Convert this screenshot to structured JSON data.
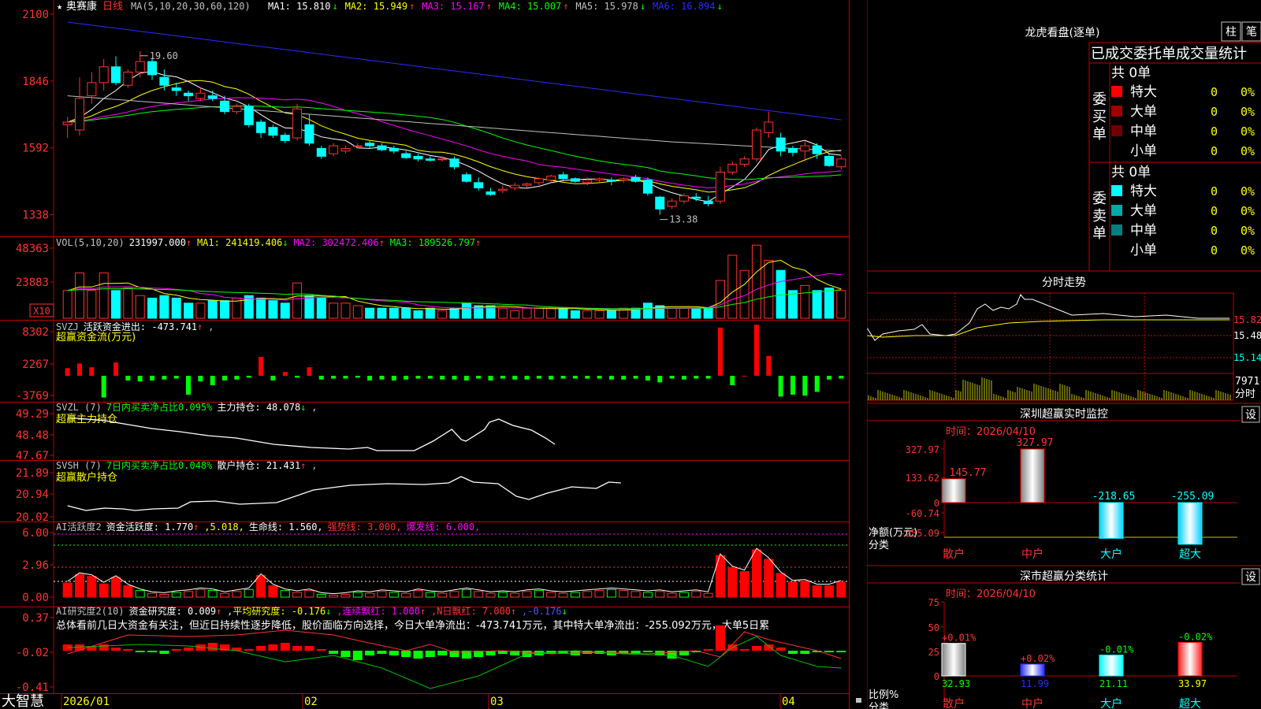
{
  "app": {
    "name": "大智慧",
    "stock_name": "奥赛康",
    "period": "日线"
  },
  "colors": {
    "up": "#ff3232",
    "down": "#00ffff",
    "grid": "#c00000",
    "ma1": "#ffffff",
    "ma2": "#ffff00",
    "ma3": "#ff00ff",
    "ma4": "#00ff00",
    "ma5": "#c0c0c0",
    "ma6": "#2b2bff"
  },
  "header": {
    "ma_label": "MA(5,10,20,30,60,120)",
    "items": [
      {
        "label": "MA1:",
        "value": "15.810",
        "arrow": "↓",
        "color": "#ffffff"
      },
      {
        "label": "MA2:",
        "value": "15.949",
        "arrow": "↑",
        "color": "#ffff00"
      },
      {
        "label": "MA3:",
        "value": "15.167",
        "arrow": "↑",
        "color": "#ff00ff"
      },
      {
        "label": "MA4:",
        "value": "15.007",
        "arrow": "↑",
        "color": "#00ff00"
      },
      {
        "label": "MA5:",
        "value": "15.978",
        "arrow": "↓",
        "color": "#c0c0c0"
      },
      {
        "label": "MA6:",
        "value": "16.894",
        "arrow": "↓",
        "color": "#2b2bff"
      }
    ]
  },
  "chart_data": [
    {
      "type": "candlestick",
      "title": "奥赛康 日线",
      "y_ticks": [
        "2100",
        "1846",
        "1592",
        "1338"
      ],
      "ylim": [
        12.8,
        21.0
      ],
      "annotations": [
        {
          "text": "19.60"
        },
        {
          "text": "13.38"
        }
      ],
      "x_labels": [
        "2026/01",
        "02",
        "03",
        "04"
      ],
      "candles": [
        {
          "o": 16.8,
          "h": 17.1,
          "l": 16.3,
          "c": 16.9
        },
        {
          "o": 16.6,
          "h": 18.6,
          "l": 16.4,
          "c": 17.8
        },
        {
          "o": 17.9,
          "h": 18.8,
          "l": 17.6,
          "c": 18.4
        },
        {
          "o": 18.4,
          "h": 19.3,
          "l": 18.1,
          "c": 19.0
        },
        {
          "o": 19.0,
          "h": 19.4,
          "l": 18.3,
          "c": 18.4
        },
        {
          "o": 18.3,
          "h": 18.9,
          "l": 18.2,
          "c": 18.8
        },
        {
          "o": 18.8,
          "h": 19.6,
          "l": 18.6,
          "c": 19.2
        },
        {
          "o": 19.2,
          "h": 19.3,
          "l": 18.5,
          "c": 18.7
        },
        {
          "o": 18.6,
          "h": 18.9,
          "l": 18.1,
          "c": 18.3
        },
        {
          "o": 18.2,
          "h": 18.4,
          "l": 17.9,
          "c": 18.1
        },
        {
          "o": 18.0,
          "h": 18.1,
          "l": 17.7,
          "c": 17.9
        },
        {
          "o": 17.8,
          "h": 18.2,
          "l": 17.7,
          "c": 18.0
        },
        {
          "o": 17.9,
          "h": 18.1,
          "l": 17.7,
          "c": 17.8
        },
        {
          "o": 17.7,
          "h": 17.9,
          "l": 17.2,
          "c": 17.3
        },
        {
          "o": 17.3,
          "h": 17.6,
          "l": 17.2,
          "c": 17.5
        },
        {
          "o": 17.5,
          "h": 17.6,
          "l": 16.7,
          "c": 16.8
        },
        {
          "o": 16.9,
          "h": 17.0,
          "l": 16.3,
          "c": 16.5
        },
        {
          "o": 16.7,
          "h": 16.8,
          "l": 16.3,
          "c": 16.4
        },
        {
          "o": 16.4,
          "h": 16.5,
          "l": 16.1,
          "c": 16.2
        },
        {
          "o": 16.3,
          "h": 17.6,
          "l": 16.2,
          "c": 17.4
        },
        {
          "o": 16.8,
          "h": 17.2,
          "l": 16.0,
          "c": 16.1
        },
        {
          "o": 15.9,
          "h": 16.0,
          "l": 15.5,
          "c": 15.6
        },
        {
          "o": 15.7,
          "h": 16.1,
          "l": 15.6,
          "c": 16.0
        },
        {
          "o": 15.8,
          "h": 16.0,
          "l": 15.7,
          "c": 15.9
        },
        {
          "o": 16.0,
          "h": 16.1,
          "l": 15.9,
          "c": 16.0
        },
        {
          "o": 16.1,
          "h": 16.2,
          "l": 15.9,
          "c": 16.0
        },
        {
          "o": 16.0,
          "h": 16.1,
          "l": 15.8,
          "c": 15.85
        },
        {
          "o": 15.9,
          "h": 16.0,
          "l": 15.7,
          "c": 15.8
        },
        {
          "o": 15.7,
          "h": 15.8,
          "l": 15.5,
          "c": 15.55
        },
        {
          "o": 15.6,
          "h": 15.7,
          "l": 15.4,
          "c": 15.5
        },
        {
          "o": 15.5,
          "h": 15.6,
          "l": 15.4,
          "c": 15.45
        },
        {
          "o": 15.5,
          "h": 15.6,
          "l": 15.4,
          "c": 15.5
        },
        {
          "o": 15.5,
          "h": 15.6,
          "l": 15.1,
          "c": 15.2
        },
        {
          "o": 14.9,
          "h": 15.0,
          "l": 14.6,
          "c": 14.65
        },
        {
          "o": 14.6,
          "h": 14.8,
          "l": 14.3,
          "c": 14.4
        },
        {
          "o": 14.25,
          "h": 14.4,
          "l": 14.1,
          "c": 14.15
        },
        {
          "o": 14.3,
          "h": 14.5,
          "l": 14.2,
          "c": 14.35
        },
        {
          "o": 14.4,
          "h": 14.6,
          "l": 14.3,
          "c": 14.5
        },
        {
          "o": 14.5,
          "h": 14.6,
          "l": 14.4,
          "c": 14.55
        },
        {
          "o": 14.6,
          "h": 14.8,
          "l": 14.5,
          "c": 14.75
        },
        {
          "o": 14.7,
          "h": 14.9,
          "l": 14.6,
          "c": 14.85
        },
        {
          "o": 14.9,
          "h": 15.0,
          "l": 14.7,
          "c": 14.75
        },
        {
          "o": 14.75,
          "h": 14.8,
          "l": 14.6,
          "c": 14.65
        },
        {
          "o": 14.6,
          "h": 14.8,
          "l": 14.5,
          "c": 14.7
        },
        {
          "o": 14.7,
          "h": 14.8,
          "l": 14.6,
          "c": 14.75
        },
        {
          "o": 14.7,
          "h": 14.8,
          "l": 14.5,
          "c": 14.65
        },
        {
          "o": 14.7,
          "h": 14.8,
          "l": 14.6,
          "c": 14.75
        },
        {
          "o": 14.8,
          "h": 14.9,
          "l": 14.6,
          "c": 14.65
        },
        {
          "o": 14.7,
          "h": 14.8,
          "l": 14.1,
          "c": 14.2
        },
        {
          "o": 14.05,
          "h": 14.1,
          "l": 13.38,
          "c": 13.6
        },
        {
          "o": 13.7,
          "h": 14.0,
          "l": 13.6,
          "c": 13.9
        },
        {
          "o": 13.9,
          "h": 14.2,
          "l": 13.8,
          "c": 14.1
        },
        {
          "o": 14.05,
          "h": 14.2,
          "l": 13.9,
          "c": 14.0
        },
        {
          "o": 13.9,
          "h": 14.1,
          "l": 13.7,
          "c": 13.8
        },
        {
          "o": 13.9,
          "h": 15.2,
          "l": 13.8,
          "c": 15.0
        },
        {
          "o": 15.0,
          "h": 15.4,
          "l": 14.9,
          "c": 15.3
        },
        {
          "o": 15.3,
          "h": 15.6,
          "l": 15.2,
          "c": 15.5
        },
        {
          "o": 15.5,
          "h": 16.7,
          "l": 15.4,
          "c": 16.6
        },
        {
          "o": 16.5,
          "h": 17.3,
          "l": 16.3,
          "c": 16.9
        },
        {
          "o": 16.3,
          "h": 16.5,
          "l": 15.6,
          "c": 15.8
        },
        {
          "o": 15.9,
          "h": 16.0,
          "l": 15.6,
          "c": 15.75
        },
        {
          "o": 15.8,
          "h": 16.2,
          "l": 15.4,
          "c": 16.0
        },
        {
          "o": 16.0,
          "h": 16.1,
          "l": 15.5,
          "c": 15.7
        },
        {
          "o": 15.6,
          "h": 15.7,
          "l": 15.2,
          "c": 15.25
        },
        {
          "o": 15.2,
          "h": 15.6,
          "l": 15.1,
          "c": 15.5
        }
      ],
      "series": [
        {
          "name": "MA1",
          "color": "#ffffff"
        },
        {
          "name": "MA2",
          "color": "#ffff00"
        },
        {
          "name": "MA3",
          "color": "#ff00ff"
        },
        {
          "name": "MA4",
          "color": "#00ff00"
        },
        {
          "name": "MA5",
          "color": "#c0c0c0"
        },
        {
          "name": "MA6",
          "color": "#2b2bff"
        }
      ]
    },
    {
      "type": "bar",
      "title": "VOL(5,10,20)",
      "y_ticks": [
        "48363",
        "23883"
      ],
      "unit_label": "X10",
      "header": [
        {
          "text": "VOL(5,10,20)",
          "color": "#c0c0c0"
        },
        {
          "text": "231997.000",
          "color": "#ffffff",
          "arrow": "↑"
        },
        {
          "text": "MA1: 241419.406",
          "color": "#ffff00",
          "arrow": "↓"
        },
        {
          "text": "MA2: 302472.406",
          "color": "#ff00ff",
          "arrow": "↑"
        },
        {
          "text": "MA3: 189526.797",
          "color": "#00ff00",
          "arrow": "↑"
        }
      ]
    },
    {
      "type": "bar",
      "title": "SVZJ",
      "y_ticks": [
        "8302",
        "2267",
        "-3769"
      ],
      "header": [
        {
          "text": "SVZJ",
          "color": "#c0c0c0"
        },
        {
          "text": "活跃资金进出: -473.741",
          "color": "#ffffff",
          "arrow": "↑"
        },
        {
          "text": ",",
          "color": "#c0c0c0"
        }
      ],
      "subtitle": "超赢资金流(万元)"
    },
    {
      "type": "line",
      "title": "SVZL",
      "y_ticks": [
        "49.29",
        "48.48",
        "47.67"
      ],
      "header": [
        {
          "text": "SVZL (7)",
          "color": "#c0c0c0"
        },
        {
          "text": "7日内买卖净占比0.095%",
          "color": "#00ff00"
        },
        {
          "text": "主力持仓: 48.078",
          "color": "#ffffff",
          "arrow": "↓"
        },
        {
          "text": ",",
          "color": "#c0c0c0"
        }
      ],
      "subtitle": "超赢主力持仓"
    },
    {
      "type": "line",
      "title": "SVSH",
      "y_ticks": [
        "21.89",
        "20.94",
        "20.02"
      ],
      "header": [
        {
          "text": "SVSH (7)",
          "color": "#c0c0c0"
        },
        {
          "text": "7日内买卖净占比0.048%",
          "color": "#00ff00"
        },
        {
          "text": "散户持仓: 21.431",
          "color": "#ffffff",
          "arrow": "↑"
        },
        {
          "text": ",",
          "color": "#c0c0c0"
        }
      ],
      "subtitle": "超赢散户持仓"
    },
    {
      "type": "bar",
      "title": "AI活跃度2",
      "y_ticks": [
        "6.00",
        "2.96",
        "0.00"
      ],
      "header": [
        {
          "text": "AI活跃度2",
          "color": "#c0c0c0"
        },
        {
          "text": "资金活跃度: 1.770",
          "color": "#ffffff",
          "arrow": "↑"
        },
        {
          "text": ",5.018,",
          "color": "#ffff00"
        },
        {
          "text": "生命线: 1.560,",
          "color": "#ffffff"
        },
        {
          "text": "强势线: 3.000,",
          "color": "#ff3232"
        },
        {
          "text": "爆发线: 6.000,",
          "color": "#ff00ff"
        }
      ]
    },
    {
      "type": "bar",
      "title": "AI研究度2(10)",
      "y_ticks": [
        "0.37",
        "-0.02",
        "-0.41"
      ],
      "header": [
        {
          "text": "AI研究度2(10)",
          "color": "#c0c0c0"
        },
        {
          "text": "资金研究度: 0.009",
          "color": "#ffffff",
          "arrow": "↑"
        },
        {
          "text": ",平均研究度: -0.176",
          "color": "#ffff00",
          "arrow": "↓"
        },
        {
          "text": ",连续飘红: 1.000",
          "color": "#ff00ff",
          "arrow": "↑"
        },
        {
          "text": ",N日飘红: 7.000",
          "color": "#ff3232",
          "arrow": "↑"
        },
        {
          "text": ",-0.176",
          "color": "#5555ff",
          "arrow": "↓"
        }
      ],
      "comment": "总体看前几日大资金有关注，但近日持续性逐步降低，股价面临方向选择，今日大单净流出：-473.741万元，其中特大单净流出：-255.092万元，大单5日累"
    },
    {
      "type": "bar",
      "title": "深圳超赢实时监控",
      "date_label": "时间：2026/04/10",
      "y_ticks": [
        "327.97",
        "133.62",
        "0",
        "-60.74",
        "-255.09"
      ],
      "ylabel": "净额(万元)",
      "xlabel": "分类",
      "categories": [
        "散户",
        "中户",
        "大户",
        "超大"
      ],
      "values": [
        145.77,
        327.97,
        -218.65,
        -255.09
      ],
      "value_labels": [
        "145.77",
        "327.97",
        "-218.65",
        "-255.09"
      ]
    },
    {
      "type": "bar",
      "title": "深市超赢分类统计",
      "date_label": "时间：2026/04/10",
      "y_ticks": [
        "75",
        "50",
        "25",
        "0"
      ],
      "ylabel": "比例%",
      "xlabel": "分类",
      "categories": [
        "散户",
        "中户",
        "大户",
        "超大"
      ],
      "values": [
        32.93,
        11.99,
        21.11,
        33.97
      ],
      "top_labels": [
        "+0.01%",
        "+0.02%",
        "-0.01%",
        "-0.02%"
      ]
    },
    {
      "type": "line",
      "title": "分时走势",
      "y_ticks": [
        "15.82",
        "15.48",
        "15.14"
      ],
      "volume_label": "7971",
      "bottom_label": "分时"
    }
  ],
  "dragon_panel": {
    "title": "龙虎看盘(逐单)",
    "btn_bar": "柱",
    "btn_line": "笔",
    "table_title": "已成交委托单成交量统计",
    "buy": {
      "side_label": "委买单",
      "total": "共 0单",
      "rows": [
        {
          "label": "特大",
          "count": "0",
          "pct": "0%",
          "color": "#ff0000"
        },
        {
          "label": "大单",
          "count": "0",
          "pct": "0%",
          "color": "#a00000"
        },
        {
          "label": "中单",
          "count": "0",
          "pct": "0%",
          "color": "#700000"
        },
        {
          "label": "小单",
          "count": "0",
          "pct": "0%",
          "color": "#000000"
        }
      ]
    },
    "sell": {
      "side_label": "委卖单",
      "total": "共 0单",
      "rows": [
        {
          "label": "特大",
          "count": "0",
          "pct": "0%",
          "color": "#00ffff"
        },
        {
          "label": "大单",
          "count": "0",
          "pct": "0%",
          "color": "#00aaaa"
        },
        {
          "label": "中单",
          "count": "0",
          "pct": "0%",
          "color": "#008080"
        },
        {
          "label": "小单",
          "count": "0",
          "pct": "0%",
          "color": "#000000"
        }
      ]
    }
  },
  "settings_btn": "设"
}
